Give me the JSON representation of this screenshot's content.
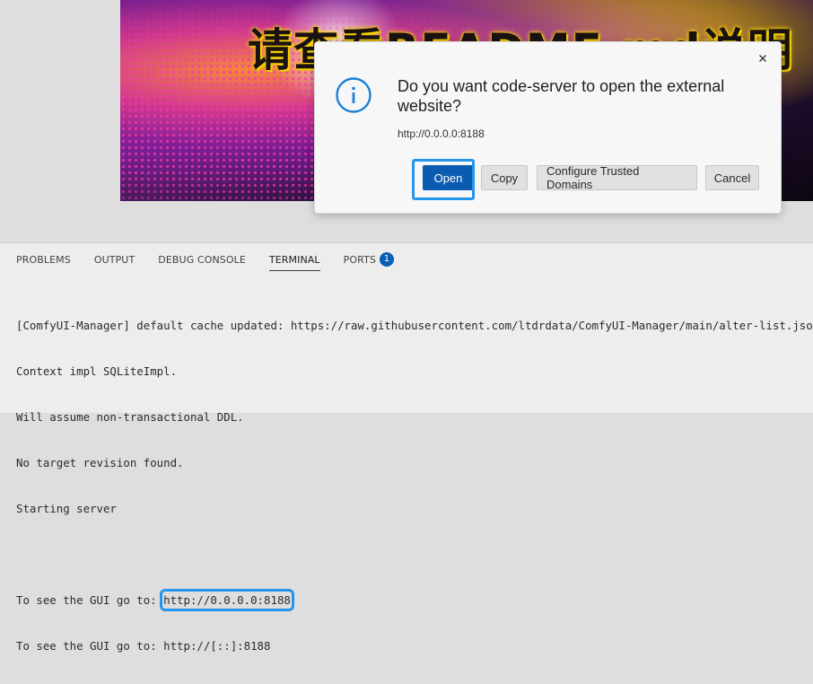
{
  "preview": {
    "banner_text": "请查看README.md说明"
  },
  "dialog": {
    "message": "Do you want code-server to open the external website?",
    "url": "http://0.0.0.0:8188",
    "buttons": {
      "open": "Open",
      "copy": "Copy",
      "configure": "Configure Trusted Domains",
      "cancel": "Cancel"
    },
    "close_icon": "close-icon",
    "info_icon": "info-icon"
  },
  "panel": {
    "tabs": [
      {
        "label": "PROBLEMS"
      },
      {
        "label": "OUTPUT"
      },
      {
        "label": "DEBUG CONSOLE"
      },
      {
        "label": "TERMINAL",
        "active": true
      },
      {
        "label": "PORTS",
        "badge": "1"
      }
    ],
    "terminal_lines": [
      "[ComfyUI-Manager] default cache updated: https://raw.githubusercontent.com/ltdrdata/ComfyUI-Manager/main/alter-list.json",
      "Context impl SQLiteImpl.",
      "Will assume non-transactional DDL.",
      "No target revision found.",
      "Starting server",
      "",
      "To see the GUI go to: ",
      "To see the GUI go to: http://[::]:8188"
    ],
    "highlighted_link": "http://0.0.0.0:8188"
  },
  "colors": {
    "accent": "#0b5bb0",
    "highlight": "#2496ed",
    "badge": "#0a5fb4"
  }
}
